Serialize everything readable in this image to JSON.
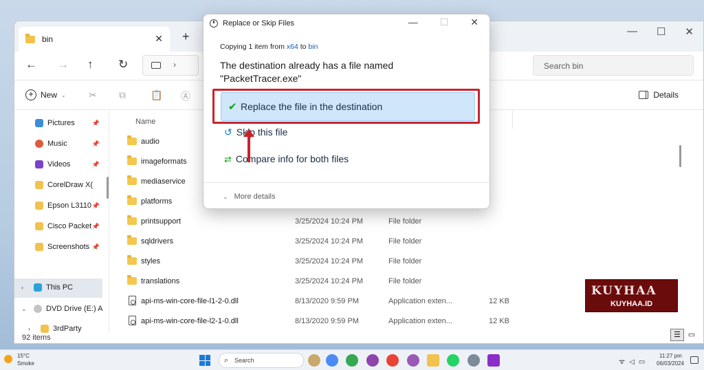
{
  "explorer": {
    "tab_label": "bin",
    "search_placeholder": "Search bin",
    "toolbar": {
      "new_label": "New",
      "details_label": "Details"
    },
    "sidebar": [
      {
        "label": "Pictures",
        "icon": "pictures-icon",
        "pinned": true
      },
      {
        "label": "Music",
        "icon": "music-icon",
        "pinned": true
      },
      {
        "label": "Videos",
        "icon": "videos-icon",
        "pinned": true
      },
      {
        "label": "CorelDraw X(",
        "icon": "folder-icon",
        "pinned": false
      },
      {
        "label": "Epson L3110",
        "icon": "folder-icon",
        "pinned": true
      },
      {
        "label": "Cisco Packet",
        "icon": "folder-icon",
        "pinned": true
      },
      {
        "label": "Screenshots",
        "icon": "folder-icon",
        "pinned": true
      }
    ],
    "sidebar_tree": [
      {
        "label": "This PC",
        "icon": "this-pc-icon"
      },
      {
        "label": "DVD Drive (E:) A",
        "icon": "dvd-drive-icon"
      },
      {
        "label": "3rdParty",
        "icon": "folder-icon"
      }
    ],
    "columns": {
      "name": "Name"
    },
    "files": [
      {
        "name": "audio",
        "date": "",
        "type": "",
        "size": "",
        "kind": "folder"
      },
      {
        "name": "imageformats",
        "date": "",
        "type": "",
        "size": "",
        "kind": "folder"
      },
      {
        "name": "mediaservice",
        "date": "",
        "type": "",
        "size": "",
        "kind": "folder"
      },
      {
        "name": "platforms",
        "date": "",
        "type": "",
        "size": "",
        "kind": "folder"
      },
      {
        "name": "printsupport",
        "date": "3/25/2024 10:24 PM",
        "type": "File folder",
        "size": "",
        "kind": "folder"
      },
      {
        "name": "sqldrivers",
        "date": "3/25/2024 10:24 PM",
        "type": "File folder",
        "size": "",
        "kind": "folder"
      },
      {
        "name": "styles",
        "date": "3/25/2024 10:24 PM",
        "type": "File folder",
        "size": "",
        "kind": "folder"
      },
      {
        "name": "translations",
        "date": "3/25/2024 10:24 PM",
        "type": "File folder",
        "size": "",
        "kind": "folder"
      },
      {
        "name": "api-ms-win-core-file-l1-2-0.dll",
        "date": "8/13/2020 9:59 PM",
        "type": "Application exten...",
        "size": "12 KB",
        "kind": "dll"
      },
      {
        "name": "api-ms-win-core-file-l2-1-0.dll",
        "date": "8/13/2020 9:59 PM",
        "type": "Application exten...",
        "size": "12 KB",
        "kind": "dll"
      }
    ],
    "status": "92 items"
  },
  "dialog": {
    "title": "Replace or Skip Files",
    "copying_prefix": "Copying 1 item from",
    "source": "x64",
    "to_word": "to",
    "destination": "bin",
    "message_line1": "The destination already has a file named",
    "message_line2": "\"PacketTracer.exe\"",
    "option_replace": "Replace the file in the destination",
    "option_skip": "Skip this file",
    "option_compare": "Compare info for both files",
    "more_details": "More details"
  },
  "watermark": {
    "top": "KUYHAA",
    "bottom": "KUYHAA.ID"
  },
  "taskbar": {
    "weather_temp": "15°C",
    "weather_desc": "Smoke",
    "search_label": "Search",
    "time": "11:27 pm",
    "date": "06/03/2024"
  },
  "colors": {
    "accent": "#0078d4",
    "highlight": "#c8232c",
    "replace_bg": "#cfe6fb",
    "check": "#13a10e"
  }
}
